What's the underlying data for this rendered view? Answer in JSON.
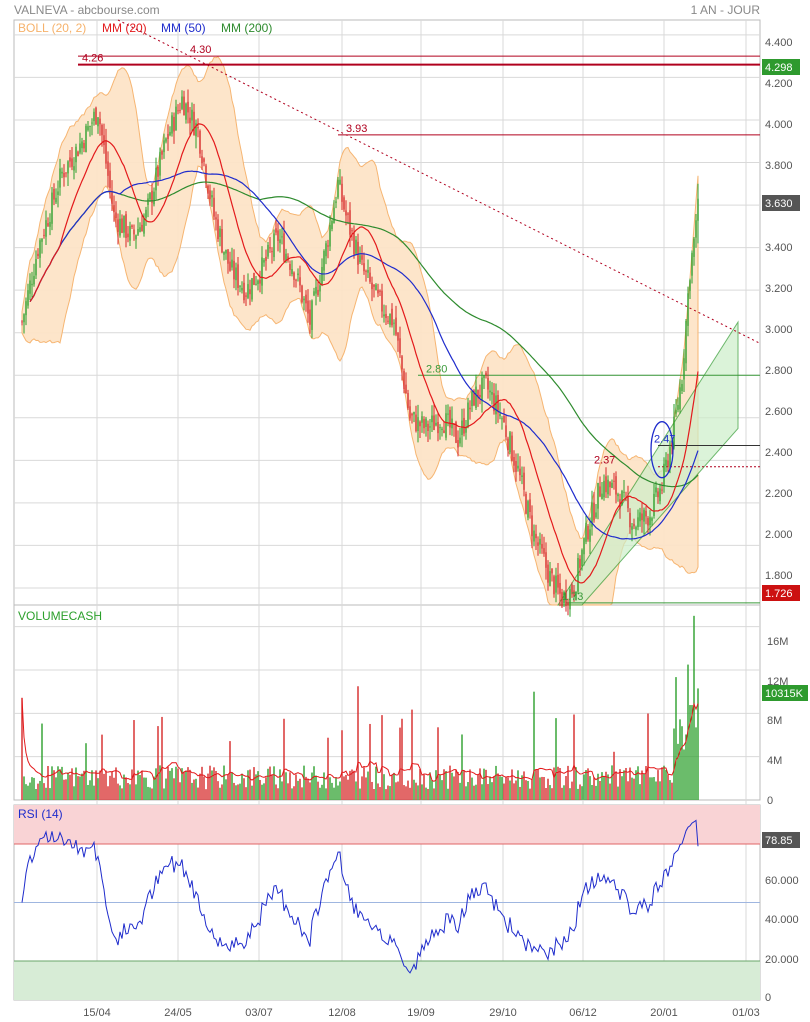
{
  "header": {
    "source": "VALNEVA - abcbourse.com",
    "period": "1 AN - JOUR"
  },
  "colors": {
    "up": "#2ca02c",
    "down": "#d62728",
    "boll_fill": "#fde4c8",
    "boll_line": "#f6b26b",
    "mm20": "#e31a1c",
    "mm50": "#1f2ccc",
    "mm200": "#2e8b2e",
    "level": "#b0001e",
    "hline_green": "#3a9a3a",
    "rsi_over": "#f9d3d5",
    "rsi_under": "#d7ecd6",
    "badge_red": "#cc1111",
    "badge_green": "#2e9a2e",
    "badge_gray": "#555555",
    "grid": "#d9d9d9"
  },
  "legend": [
    {
      "label": "BOLL (20, 2)",
      "color": "#f6b26b"
    },
    {
      "label": "MM (20)",
      "color": "#e31a1c"
    },
    {
      "label": "MM (50)",
      "color": "#1f2ccc"
    },
    {
      "label": "MM (200)",
      "color": "#2e8b2e"
    }
  ],
  "x_axis": {
    "tick_labels": [
      "15/04",
      "24/05",
      "03/07",
      "12/08",
      "19/09",
      "29/10",
      "06/12",
      "20/01",
      "01/03"
    ]
  },
  "price_panel": {
    "y_ticks": [
      "4.400",
      "4.200",
      "4.000",
      "3.800",
      "3.600",
      "3.400",
      "3.200",
      "3.000",
      "2.800",
      "2.600",
      "2.400",
      "2.200",
      "2.000",
      "1.800"
    ],
    "ylim": [
      1.72,
      4.47
    ],
    "badges": [
      {
        "value": "4.298",
        "kind": "green"
      },
      {
        "value": "3.630",
        "kind": "gray"
      },
      {
        "value": "1.726",
        "kind": "red"
      }
    ],
    "annotations": [
      {
        "text": "4.26",
        "price": 4.26
      },
      {
        "text": "4.30",
        "price": 4.3
      },
      {
        "text": "3.93",
        "price": 3.93
      },
      {
        "text": "2.80",
        "price": 2.8
      },
      {
        "text": "2.37",
        "price": 2.37
      },
      {
        "text": "2.47",
        "price": 2.47
      },
      {
        "text": "1.73",
        "price": 1.73
      }
    ]
  },
  "volume_panel": {
    "title": "VOLUMECASH",
    "y_ticks": [
      "16M",
      "12M",
      "8M",
      "4M",
      "0"
    ],
    "ylim": [
      0,
      18
    ],
    "badge": "10315K"
  },
  "rsi_panel": {
    "title": "RSI (14)",
    "y_ticks": [
      "80.000",
      "60.000",
      "40.000",
      "20.000",
      "0"
    ],
    "ylim": [
      0,
      100
    ],
    "badge": "78.85",
    "upper_band": 80,
    "lower_band": 20,
    "mid": 50
  },
  "chart_data": {
    "type": "candlestick",
    "title": "VALNEVA",
    "period": "1 AN - JOUR",
    "price": {
      "approx_closes_by_date": {
        "15/04": 3.8,
        "24/05": 3.75,
        "03/07": 3.2,
        "12/08": 3.5,
        "19/09": 2.65,
        "29/10": 2.72,
        "06/12": 1.85,
        "20/01": 2.08,
        "last": 3.63
      },
      "last_close": 3.63,
      "period_high": 4.3,
      "period_low": 1.73,
      "support_resistance": [
        4.26,
        4.3,
        3.93,
        2.8,
        2.47,
        2.37,
        1.73
      ],
      "badges": [
        4.298,
        3.63,
        1.726
      ]
    },
    "volume": {
      "unit": "M",
      "last_value_label": "10315K",
      "max_approx": 17
    },
    "rsi": {
      "period": 14,
      "last": 78.85,
      "bands": [
        20,
        80
      ]
    }
  }
}
